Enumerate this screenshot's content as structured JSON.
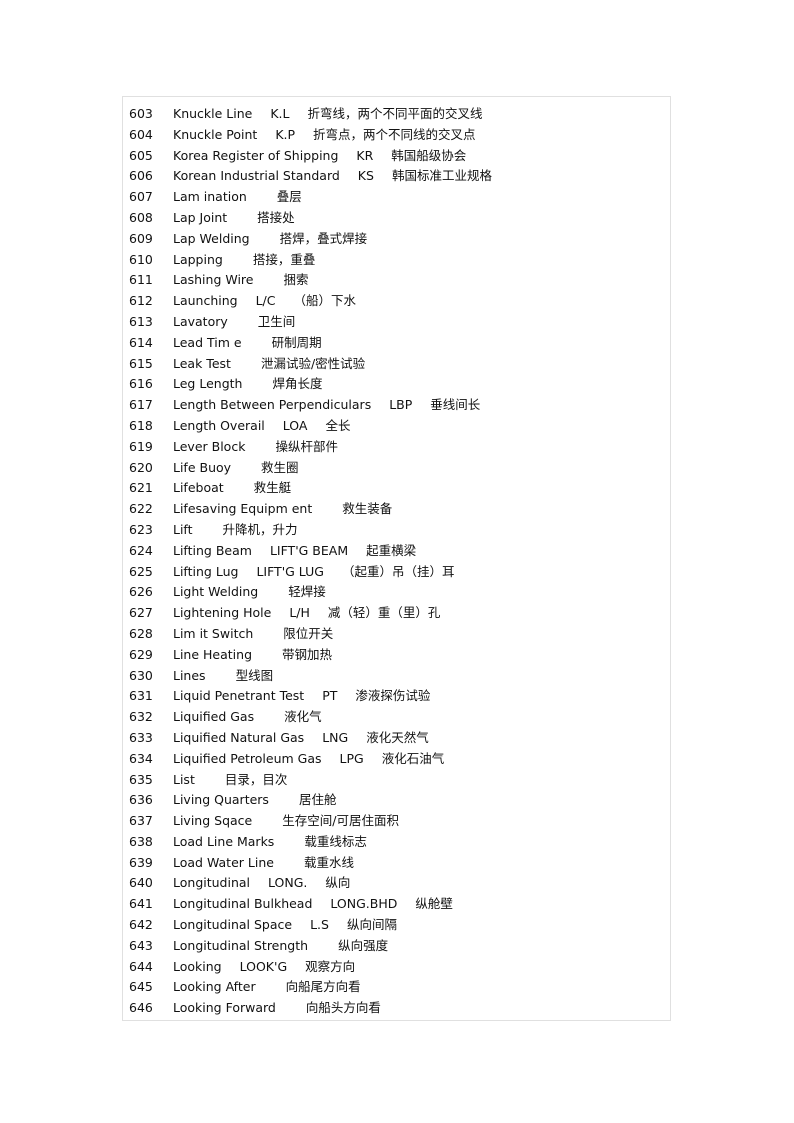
{
  "entries": [
    {
      "num": "603",
      "term": "Knuckle Line",
      "abbr": "K.L",
      "zh": "折弯线，两个不同平面的交叉线"
    },
    {
      "num": "604",
      "term": "Knuckle Point",
      "abbr": "K.P",
      "zh": "折弯点，两个不同线的交叉点"
    },
    {
      "num": "605",
      "term": "Korea Register of Shipping",
      "abbr": "KR",
      "zh": "韩国船级协会"
    },
    {
      "num": "606",
      "term": "Korean Industrial Standard",
      "abbr": "KS",
      "zh": "韩国标准工业规格"
    },
    {
      "num": "607",
      "term": "Lam ination",
      "abbr": "",
      "zh": "叠层"
    },
    {
      "num": "608",
      "term": "Lap Joint",
      "abbr": "",
      "zh": "搭接处"
    },
    {
      "num": "609",
      "term": "Lap Welding",
      "abbr": "",
      "zh": "搭焊，叠式焊接"
    },
    {
      "num": "610",
      "term": "Lapping",
      "abbr": "",
      "zh": "搭接，重叠"
    },
    {
      "num": "611",
      "term": "Lashing Wire",
      "abbr": "",
      "zh": "捆索"
    },
    {
      "num": "612",
      "term": "Launching",
      "abbr": "L/C",
      "zh": "（船）下水"
    },
    {
      "num": "613",
      "term": "Lavatory",
      "abbr": "",
      "zh": "卫生间"
    },
    {
      "num": "614",
      "term": "Lead Tim e",
      "abbr": "",
      "zh": "研制周期"
    },
    {
      "num": "615",
      "term": "Leak Test",
      "abbr": "",
      "zh": "泄漏试验/密性试验"
    },
    {
      "num": "616",
      "term": "Leg Length",
      "abbr": "",
      "zh": "焊角长度"
    },
    {
      "num": "617",
      "term": "Length Between Perpendiculars",
      "abbr": "LBP",
      "zh": "垂线间长"
    },
    {
      "num": "618",
      "term": "Length Overail",
      "abbr": "LOA",
      "zh": "全长"
    },
    {
      "num": "619",
      "term": "Lever Block",
      "abbr": "",
      "zh": "操纵杆部件"
    },
    {
      "num": "620",
      "term": "Life Buoy",
      "abbr": "",
      "zh": "救生圈"
    },
    {
      "num": "621",
      "term": "Lifeboat",
      "abbr": "",
      "zh": "救生艇"
    },
    {
      "num": "622",
      "term": "Lifesaving Equipm ent",
      "abbr": "",
      "zh": "救生装备"
    },
    {
      "num": "623",
      "term": "Lift",
      "abbr": "",
      "zh": "升降机，升力"
    },
    {
      "num": "624",
      "term": "Lifting Beam",
      "abbr": "LIFT'G BEAM",
      "zh": "起重横梁"
    },
    {
      "num": "625",
      "term": "Lifting Lug",
      "abbr": "LIFT'G LUG",
      "zh": "（起重）吊（挂）耳"
    },
    {
      "num": "626",
      "term": "Light Welding",
      "abbr": "",
      "zh": "轻焊接"
    },
    {
      "num": "627",
      "term": "Lightening Hole",
      "abbr": "L/H",
      "zh": "减（轻）重（里）孔"
    },
    {
      "num": "628",
      "term": "Lim it Switch",
      "abbr": "",
      "zh": "限位开关"
    },
    {
      "num": "629",
      "term": "Line Heating",
      "abbr": "",
      "zh": "带钢加热"
    },
    {
      "num": "630",
      "term": "Lines",
      "abbr": "",
      "zh": "型线图"
    },
    {
      "num": "631",
      "term": "Liquid Penetrant Test",
      "abbr": "PT",
      "zh": "渗液探伤试验"
    },
    {
      "num": "632",
      "term": "Liquified Gas",
      "abbr": "",
      "zh": "液化气"
    },
    {
      "num": "633",
      "term": "Liquified Natural Gas",
      "abbr": "LNG",
      "zh": "液化天然气"
    },
    {
      "num": "634",
      "term": "Liquified Petroleum  Gas",
      "abbr": "LPG",
      "zh": "液化石油气"
    },
    {
      "num": "635",
      "term": "List",
      "abbr": "",
      "zh": "目录，目次"
    },
    {
      "num": "636",
      "term": "Living Quarters",
      "abbr": "",
      "zh": "居住舱"
    },
    {
      "num": "637",
      "term": "Living Sqace",
      "abbr": "",
      "zh": "生存空间/可居住面积"
    },
    {
      "num": "638",
      "term": "Load Line Marks",
      "abbr": "",
      "zh": "载重线标志"
    },
    {
      "num": "639",
      "term": "Load Water Line",
      "abbr": "",
      "zh": "载重水线"
    },
    {
      "num": "640",
      "term": "Longitudinal",
      "abbr": "LONG.",
      "zh": "纵向"
    },
    {
      "num": "641",
      "term": "Longitudinal Bulkhead",
      "abbr": "LONG.BHD",
      "zh": "纵舱壁"
    },
    {
      "num": "642",
      "term": "Longitudinal Space",
      "abbr": "L.S",
      "zh": "纵向间隔"
    },
    {
      "num": "643",
      "term": "Longitudinal Strength",
      "abbr": "",
      "zh": "纵向强度"
    },
    {
      "num": "644",
      "term": "Looking",
      "abbr": "LOOK'G",
      "zh": "观察方向"
    },
    {
      "num": "645",
      "term": "Looking After",
      "abbr": "",
      "zh": "向船尾方向看"
    },
    {
      "num": "646",
      "term": "Looking Forward",
      "abbr": "",
      "zh": "向船头方向看"
    }
  ]
}
